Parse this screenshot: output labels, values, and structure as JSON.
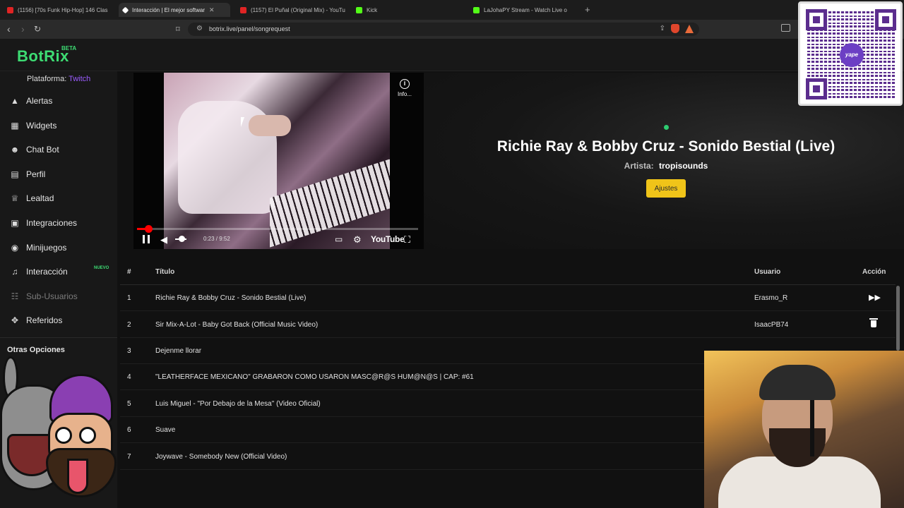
{
  "browser": {
    "tabs": [
      {
        "label": "(1156) [70s Funk Hip-Hop] 146 Clas",
        "color": "#e02424",
        "active": false
      },
      {
        "label": "Interacción | El mejor softwar",
        "color": "#ffffff",
        "active": true
      },
      {
        "label": "(1157) El Puñal (Original Mix) - YouTu",
        "color": "#e02424",
        "active": false
      },
      {
        "label": "Kick",
        "color": "#53fc18",
        "active": false
      },
      {
        "label": "LaJohaPY Stream - Watch Live o",
        "color": "#53fc18",
        "active": false
      }
    ],
    "url": "botrix.live/panel/songrequest"
  },
  "app": {
    "logo": "BotRix",
    "beta": "BETA"
  },
  "sidebar": {
    "platform_label": "Plataforma:",
    "platform_value": "Twitch",
    "items": [
      {
        "label": "Alertas",
        "icon": "warning-icon"
      },
      {
        "label": "Widgets",
        "icon": "grid-icon"
      },
      {
        "label": "Chat Bot",
        "icon": "robot-icon"
      },
      {
        "label": "Perfil",
        "icon": "id-card-icon"
      },
      {
        "label": "Lealtad",
        "icon": "trophy-icon"
      },
      {
        "label": "Integraciones",
        "icon": "plug-icon"
      },
      {
        "label": "Minijuegos",
        "icon": "gamepad-icon"
      },
      {
        "label": "Interacción",
        "icon": "music-icon",
        "badge": "NUEVO"
      },
      {
        "label": "Sub-Usuarios",
        "icon": "users-icon",
        "disabled": true
      },
      {
        "label": "Referidos",
        "icon": "handshake-icon"
      }
    ],
    "other_options": "Otras Opciones"
  },
  "player": {
    "time": "0:23 / 9:52",
    "info": "Info...",
    "progress": 0.04,
    "brand": "YouTube"
  },
  "now_playing": {
    "title": "Richie Ray & Bobby Cruz - Sonido Bestial (Live)",
    "artist_label": "Artista:",
    "artist": "tropisounds",
    "settings_button": "Ajustes"
  },
  "queue": {
    "headers": {
      "num": "#",
      "title": "Título",
      "user": "Usuario",
      "action": "Acción"
    },
    "rows": [
      {
        "num": "1",
        "title": "Richie Ray & Bobby Cruz - Sonido Bestial (Live)",
        "user": "Erasmo_R",
        "action": "skip"
      },
      {
        "num": "2",
        "title": "Sir Mix-A-Lot - Baby Got Back (Official Music Video)",
        "user": "IsaacPB74",
        "action": "delete"
      },
      {
        "num": "3",
        "title": "Dejenme llorar",
        "user": "",
        "action": ""
      },
      {
        "num": "4",
        "title": "\"LEATHERFACE MEXICANO\" GRABARON COMO USARON MASC@R@S HUM@N@S | CAP: #61",
        "user": "",
        "action": ""
      },
      {
        "num": "5",
        "title": "Luis Miguel - \"Por Debajo de la Mesa\" (Video Oficial)",
        "user": "",
        "action": ""
      },
      {
        "num": "6",
        "title": "Suave",
        "user": "",
        "action": ""
      },
      {
        "num": "7",
        "title": "Joywave - Somebody New (Official Video)",
        "user": "",
        "action": ""
      }
    ]
  },
  "overlay": {
    "qr_label": "yape"
  }
}
